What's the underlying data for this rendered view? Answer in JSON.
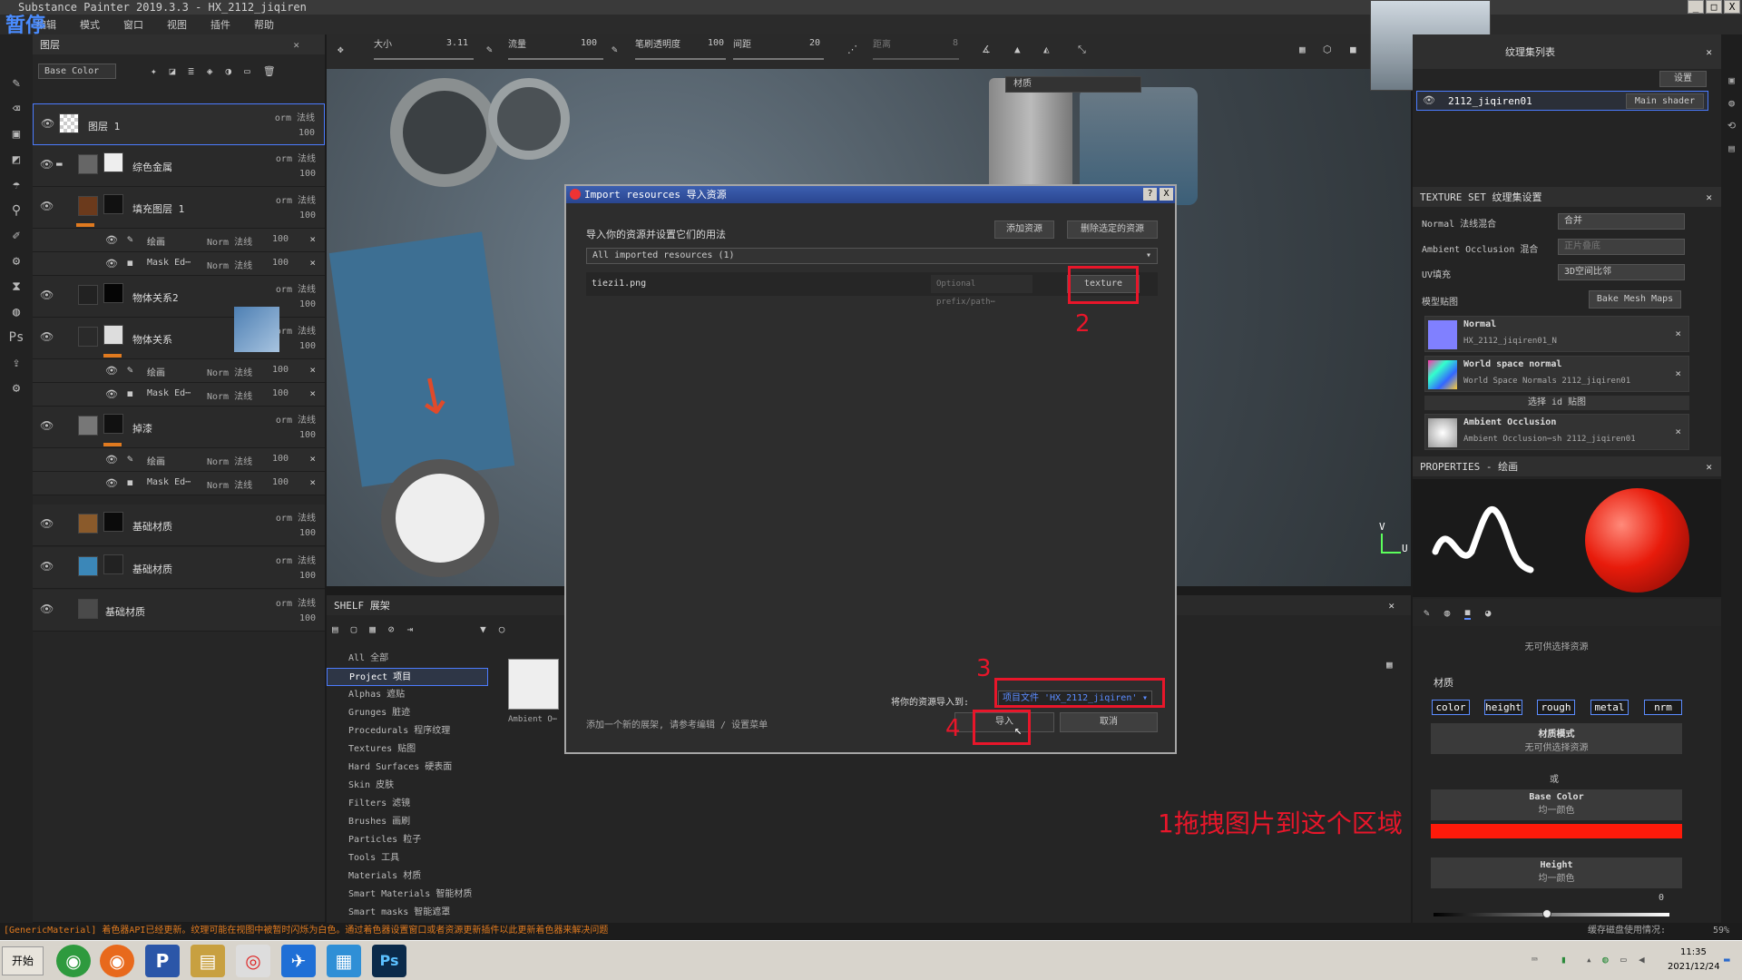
{
  "window": {
    "title": "Substance Painter 2019.3.3 - HX_2112_jiqiren",
    "pause_label": "暂停"
  },
  "menu": [
    "编辑",
    "模式",
    "窗口",
    "视图",
    "插件",
    "帮助"
  ],
  "toolbar": {
    "size_label": "大小",
    "size_value": "3.11",
    "flow_label": "流量",
    "flow_value": "100",
    "stroke_opacity_label": "笔刷透明度",
    "stroke_opacity_value": "100",
    "spacing_label": "间距",
    "spacing_value": "20",
    "distance_label": "距离",
    "distance_value": "8"
  },
  "layers_panel": {
    "title": "图层",
    "channel_select": "Base Color",
    "layers": [
      {
        "name": "图层 1",
        "blend": "orm 法线",
        "opacity": "100"
      },
      {
        "name": "综色金属",
        "blend": "orm 法线",
        "opacity": "100"
      },
      {
        "name": "填充图层 1",
        "blend": "orm 法线",
        "opacity": "100"
      },
      {
        "name": "绘画",
        "blend": "Norm 法线",
        "opacity": "100"
      },
      {
        "name": "Mask Ed⋯",
        "blend": "Norm 法线",
        "opacity": "100"
      },
      {
        "name": "物体关系2",
        "blend": "orm 法线",
        "opacity": "100"
      },
      {
        "name": "物体关系",
        "blend": "orm 法线",
        "opacity": "100"
      },
      {
        "name": "绘画",
        "blend": "Norm 法线",
        "opacity": "100"
      },
      {
        "name": "Mask Ed⋯",
        "blend": "Norm 法线",
        "opacity": "100"
      },
      {
        "name": "掉漆",
        "blend": "orm 法线",
        "opacity": "100"
      },
      {
        "name": "绘画",
        "blend": "Norm 法线",
        "opacity": "100"
      },
      {
        "name": "Mask Ed⋯",
        "blend": "Norm 法线",
        "opacity": "100"
      },
      {
        "name": "基础材质",
        "blend": "orm 法线",
        "opacity": "100"
      },
      {
        "name": "基础材质",
        "blend": "orm 法线",
        "opacity": "100"
      },
      {
        "name": "基础材质",
        "blend": "orm 法线",
        "opacity": "100"
      }
    ]
  },
  "viewport": {
    "material_label": "材质",
    "axis_v": "V",
    "axis_u": "U"
  },
  "dialog": {
    "title": "Import resources 导入资源",
    "heading": "导入你的资源并设置它们的用法",
    "add_button": "添加资源",
    "remove_button": "删除选定的资源",
    "filter_select": "All imported resources (1)",
    "file_name": "tiezi1.png",
    "prefix_placeholder": "Optional prefix/path⋯",
    "usage_button": "texture",
    "hint_text": "添加一个新的展架, 请参考编辑 / 设置菜单",
    "import_to_label": "将你的资源导入到:",
    "import_to_value": "项目文件 'HX_2112_jiqiren'",
    "import_button": "导入",
    "cancel_button": "取消",
    "help": "?",
    "close": "X"
  },
  "annotations": [
    "2",
    "3",
    "4",
    "1拖拽图片到这个区域"
  ],
  "shelf": {
    "title": "SHELF 展架",
    "items": [
      "All 全部",
      "Project 项目",
      "Alphas 遮贴",
      "Grunges 脏迹",
      "Procedurals 程序纹理",
      "Textures 贴图",
      "Hard Surfaces 硬表面",
      "Skin 皮肤",
      "Filters 滤镜",
      "Brushes 画刷",
      "Particles 粒子",
      "Tools 工具",
      "Materials 材质",
      "Smart Materials 智能材质",
      "Smart masks 智能遮罩"
    ],
    "thumb_label": "Ambient O⋯"
  },
  "texture_list": {
    "title": "纹理集列表",
    "settings": "设置",
    "set_name": "2112_jiqiren01",
    "shader": "Main shader"
  },
  "texture_settings": {
    "title": "TEXTURE SET 纹理集设置",
    "normal_mix_label": "Normal 法线混合",
    "normal_mix_value": "合并",
    "ao_mix_label": "Ambient Occlusion 混合",
    "ao_mix_value": "正片叠底",
    "uv_label": "UV填充",
    "uv_value": "3D空间比邻",
    "mesh_maps_label": "模型贴图",
    "bake_button": "Bake Mesh Maps",
    "maps": [
      {
        "name": "Normal",
        "file": "HX_2112_jiqiren01_N"
      },
      {
        "name": "World space normal",
        "file": "World Space Normals 2112_jiqiren01"
      },
      {
        "name": "Ambient Occlusion",
        "file": "Ambient Occlusion⋯sh 2112_jiqiren01"
      }
    ],
    "select_id": "选择 id 贴图"
  },
  "properties": {
    "title": "PROPERTIES - 绘画",
    "stencil_sub": "无可供选择资源",
    "material_label": "材质",
    "channels": [
      "color",
      "height",
      "rough",
      "metal",
      "nrm"
    ],
    "material_mode": "材质模式",
    "material_mode_sub": "无可供选择资源",
    "or": "或",
    "base_color": "Base Color",
    "base_color_sub": "均一颜色",
    "height": "Height",
    "height_sub": "均一颜色",
    "height_value": "0"
  },
  "status": {
    "message": "[GenericMaterial] 着色器API已经更新。纹理可能在视图中被暂时闪烁为白色。通过着色器设置窗口或者资源更新插件以此更新着色器来解决问题",
    "cache_label": "缓存磁盘使用情况:",
    "cache_value": "59%"
  },
  "taskbar": {
    "start": "开始",
    "time": "11:35",
    "date": "2021/12/24"
  },
  "colors": {
    "accent_red": "#e8162a",
    "orange": "#e07a1f",
    "dialog_title": "#3459a8",
    "base_color": "#ff1a0a"
  }
}
